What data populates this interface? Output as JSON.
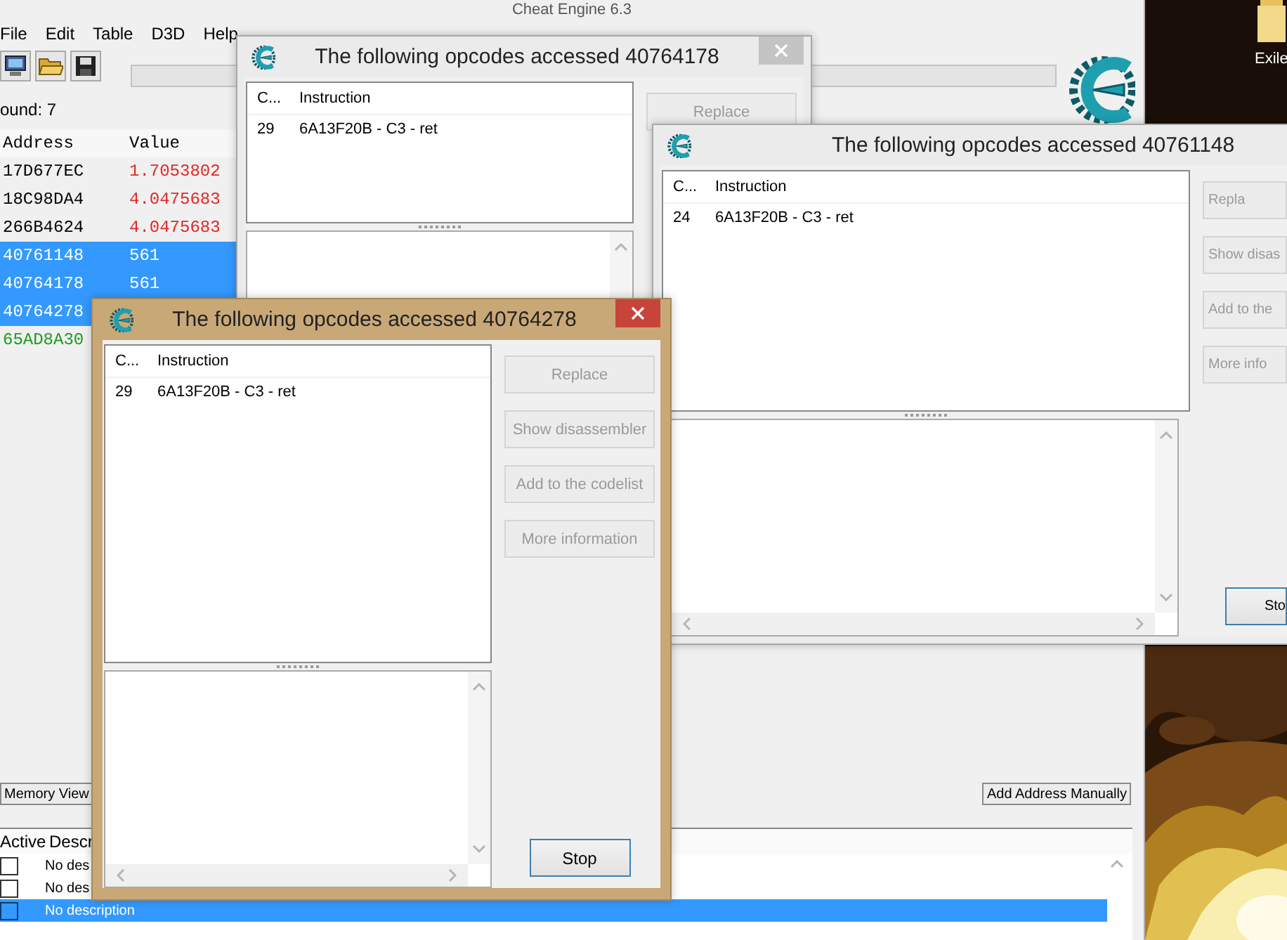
{
  "main_window": {
    "title": "Cheat Engine 6.3",
    "menu": [
      "File",
      "Edit",
      "Table",
      "D3D",
      "Help"
    ],
    "scan_progress": {
      "level": 0
    },
    "found": "ound: 7",
    "address_list": {
      "columns": [
        "Address",
        "Value"
      ],
      "rows": [
        {
          "address": "17D677EC",
          "value": "1.7053802",
          "kind": "changed",
          "selected": false
        },
        {
          "address": "18C98DA4",
          "value": "4.0475683",
          "kind": "changed",
          "selected": false
        },
        {
          "address": "266B4624",
          "value": "4.0475683",
          "kind": "changed",
          "selected": false
        },
        {
          "address": "40761148",
          "value": "561",
          "kind": "plain",
          "selected": true
        },
        {
          "address": "40764178",
          "value": "561",
          "kind": "plain",
          "selected": true
        },
        {
          "address": "40764278",
          "kind": "plain",
          "selected": true
        },
        {
          "address": "65AD8A30",
          "kind": "static",
          "selected": false
        }
      ]
    },
    "memory_view_button": "Memory View",
    "add_address_button": "Add Address Manually",
    "cheat_table": {
      "columns": [
        "Active",
        "Descr"
      ],
      "rows": [
        {
          "active": false,
          "description": "No des",
          "selected": false
        },
        {
          "active": false,
          "description": "No des",
          "selected": false
        },
        {
          "active": false,
          "description": "No description",
          "selected": true
        }
      ]
    }
  },
  "desktop": {
    "icon_label": "Exile"
  },
  "opcode_windows": [
    {
      "title": "The following opcodes accessed 40764178",
      "focused": false,
      "columns": [
        "C...",
        "Instruction"
      ],
      "rows": [
        {
          "count": "29",
          "instruction": "6A13F20B - C3 - ret"
        }
      ],
      "buttons": [
        {
          "label": "Replace",
          "disabled": true
        }
      ]
    },
    {
      "title": "The following opcodes accessed 40761148",
      "focused": false,
      "columns": [
        "C...",
        "Instruction"
      ],
      "rows": [
        {
          "count": "24",
          "instruction": "6A13F20B - C3 - ret"
        }
      ],
      "buttons": [
        {
          "label": "Repla",
          "disabled": true
        },
        {
          "label": "Show disas",
          "disabled": true
        },
        {
          "label": "Add to the",
          "disabled": true
        },
        {
          "label": "More info",
          "disabled": true
        }
      ],
      "stop_button": {
        "label": "Sto",
        "disabled": false
      }
    },
    {
      "title": "The following opcodes accessed 40764278",
      "focused": true,
      "columns": [
        "C...",
        "Instruction"
      ],
      "rows": [
        {
          "count": "29",
          "instruction": "6A13F20B - C3 - ret"
        }
      ],
      "buttons": [
        {
          "label": "Replace",
          "disabled": true
        },
        {
          "label": "Show disassembler",
          "disabled": true
        },
        {
          "label": "Add to the codelist",
          "disabled": true
        },
        {
          "label": "More information",
          "disabled": true
        }
      ],
      "stop_button": {
        "label": "Stop",
        "disabled": false
      }
    }
  ]
}
